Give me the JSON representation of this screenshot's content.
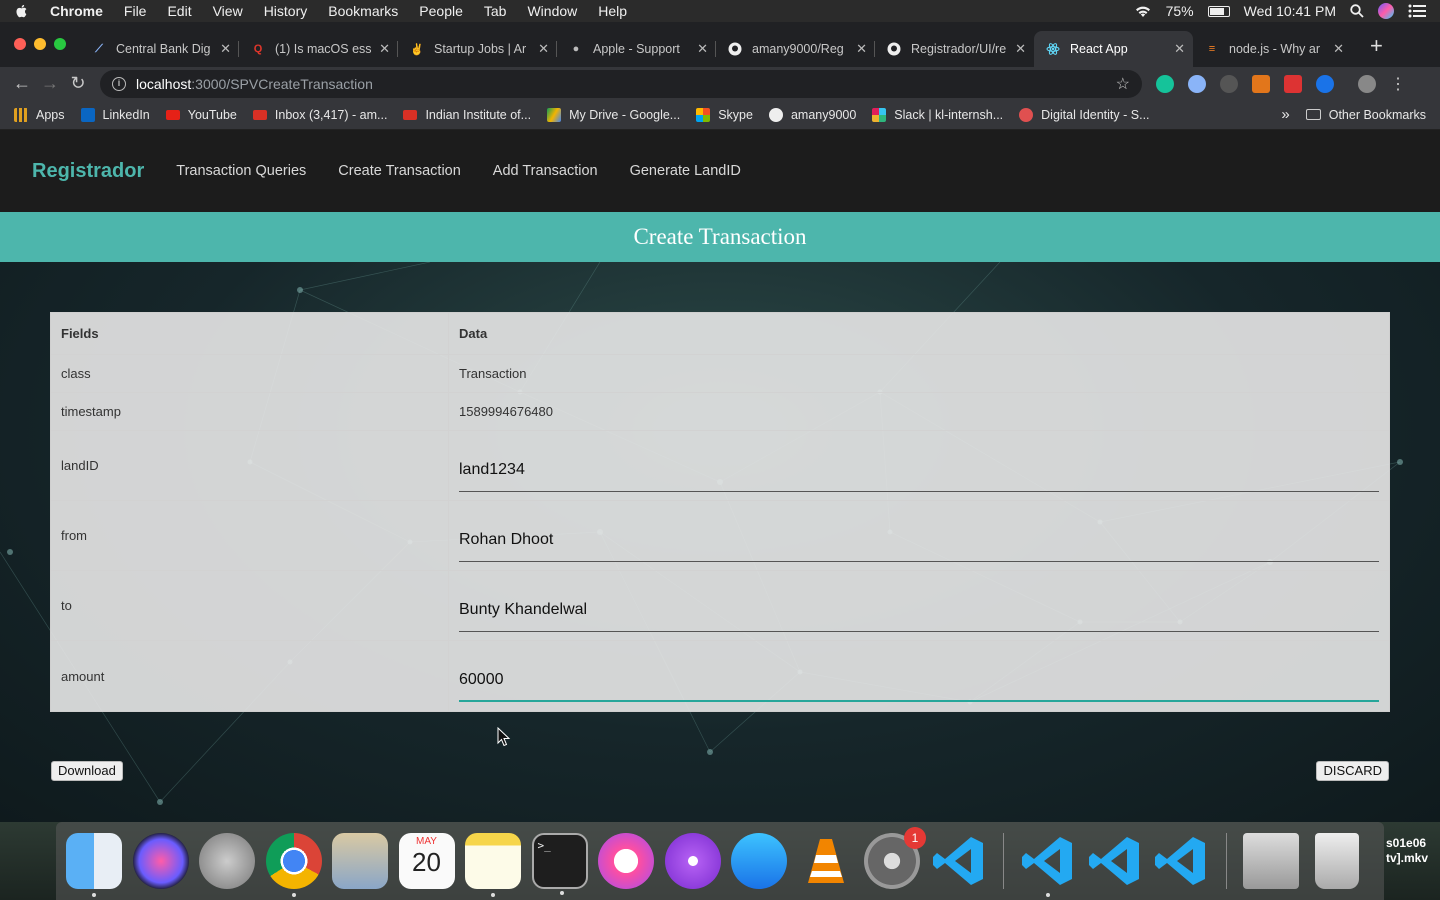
{
  "menubar": {
    "app": "Chrome",
    "items": [
      "File",
      "Edit",
      "View",
      "History",
      "Bookmarks",
      "People",
      "Tab",
      "Window",
      "Help"
    ],
    "battery": "75%",
    "clock": "Wed 10:41 PM"
  },
  "tabs": [
    {
      "title": "Central Bank Dig",
      "icon": "bank-icon"
    },
    {
      "title": "(1) Is macOS ess",
      "icon": "quora-icon"
    },
    {
      "title": "Startup Jobs | Ar",
      "icon": "angellist-icon"
    },
    {
      "title": "Apple - Support",
      "icon": "apple-icon"
    },
    {
      "title": "amany9000/Reg",
      "icon": "github-icon"
    },
    {
      "title": "Registrador/UI/re",
      "icon": "github-icon"
    },
    {
      "title": "React App",
      "icon": "react-icon",
      "active": true
    },
    {
      "title": "node.js - Why ar",
      "icon": "stackoverflow-icon"
    }
  ],
  "address": {
    "host": "localhost",
    "path": ":3000/SPVCreateTransaction"
  },
  "bookmarks": [
    {
      "label": "Apps",
      "color": "#e0a020"
    },
    {
      "label": "LinkedIn",
      "color": "#0a66c2"
    },
    {
      "label": "YouTube",
      "color": "#e62117"
    },
    {
      "label": "Inbox (3,417) - am...",
      "color": "#d93025"
    },
    {
      "label": "Indian Institute of...",
      "color": "#d93025"
    },
    {
      "label": "My Drive - Google...",
      "color": "#f4b400"
    },
    {
      "label": "Skype",
      "color": "#f25022"
    },
    {
      "label": "amany9000",
      "color": "#ffffff"
    },
    {
      "label": "Slack | kl-internsh...",
      "color": "#611f69"
    },
    {
      "label": "Digital Identity - S...",
      "color": "#e05050"
    }
  ],
  "bookmarks_other": "Other Bookmarks",
  "bookmarks_more": "»",
  "app": {
    "brand": "Registrador",
    "nav": [
      "Transaction Queries",
      "Create Transaction",
      "Add Transaction",
      "Generate LandID"
    ],
    "page_title": "Create Transaction",
    "accent": "#4db6ac"
  },
  "table": {
    "headers": {
      "fields": "Fields",
      "data": "Data"
    },
    "rows": {
      "class": {
        "field": "class",
        "value": "Transaction"
      },
      "timestamp": {
        "field": "timestamp",
        "value": "1589994676480"
      },
      "landID": {
        "field": "landID",
        "value": "land1234"
      },
      "from": {
        "field": "from",
        "value": "Rohan Dhoot"
      },
      "to": {
        "field": "to",
        "value": "Bunty Khandelwal"
      },
      "amount": {
        "field": "amount",
        "value": "60000"
      }
    }
  },
  "buttons": {
    "download": "Download",
    "discard": "DISCARD"
  },
  "dock": {
    "calendar_month": "MAY",
    "calendar_day": "20",
    "prefs_badge": "1",
    "desktop_file": "s01e06\ntv].mkv"
  }
}
